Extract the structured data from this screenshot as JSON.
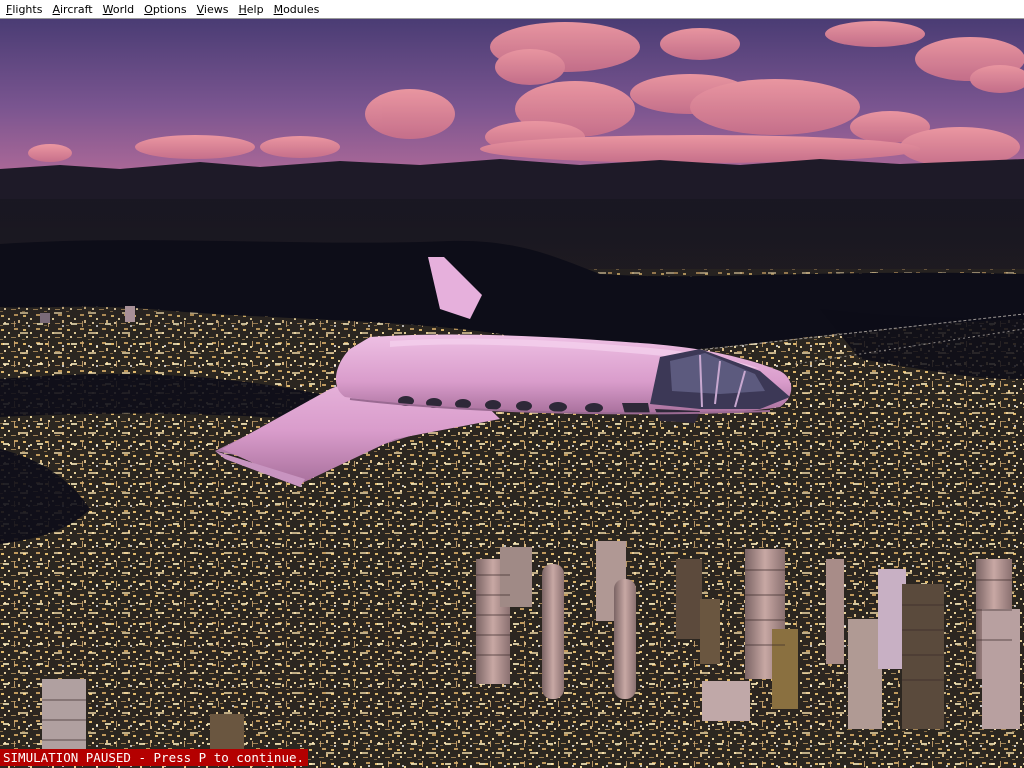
{
  "menubar": {
    "items": [
      {
        "label": "Flights"
      },
      {
        "label": "Aircraft"
      },
      {
        "label": "World"
      },
      {
        "label": "Options"
      },
      {
        "label": "Views"
      },
      {
        "label": "Help"
      },
      {
        "label": "Modules"
      }
    ]
  },
  "scene": {
    "description_icon": "flight-sim-3d-view",
    "sky_top_color": "#4a3c74",
    "sky_horizon_color": "#b06a98",
    "cloud_color": "#e0879a",
    "aircraft_color": "#e0a8d6",
    "city_light_color": "#e8c070"
  },
  "status": {
    "text": "SIMULATION PAUSED - Press P to continue."
  }
}
